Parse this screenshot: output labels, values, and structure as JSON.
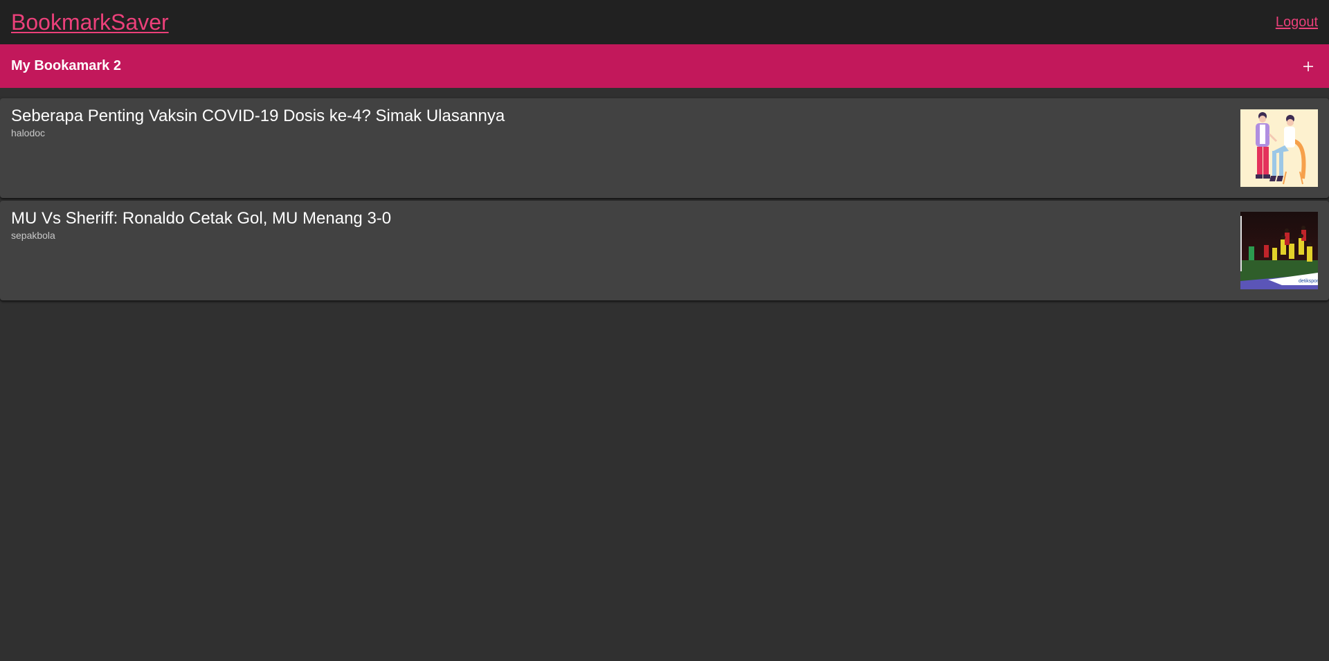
{
  "header": {
    "brand": "BookmarkSaver",
    "logout_label": "Logout"
  },
  "folder": {
    "title": "My Bookamark 2",
    "add_icon": "plus-icon"
  },
  "bookmarks": [
    {
      "title": "Seberapa Penting Vaksin COVID-19 Dosis ke-4? Simak Ulasannya",
      "source": "halodoc",
      "thumbnail": "vaccine-illustration"
    },
    {
      "title": "MU Vs Sheriff: Ronaldo Cetak Gol, MU Menang 3-0",
      "source": "sepakbola",
      "thumbnail": "football-match-photo",
      "thumbnail_watermark": "detiksport"
    }
  ],
  "colors": {
    "accent": "#ec407a",
    "toolbar": "#c2185b",
    "appbar": "#212121",
    "background": "#303030",
    "card": "#424242"
  }
}
